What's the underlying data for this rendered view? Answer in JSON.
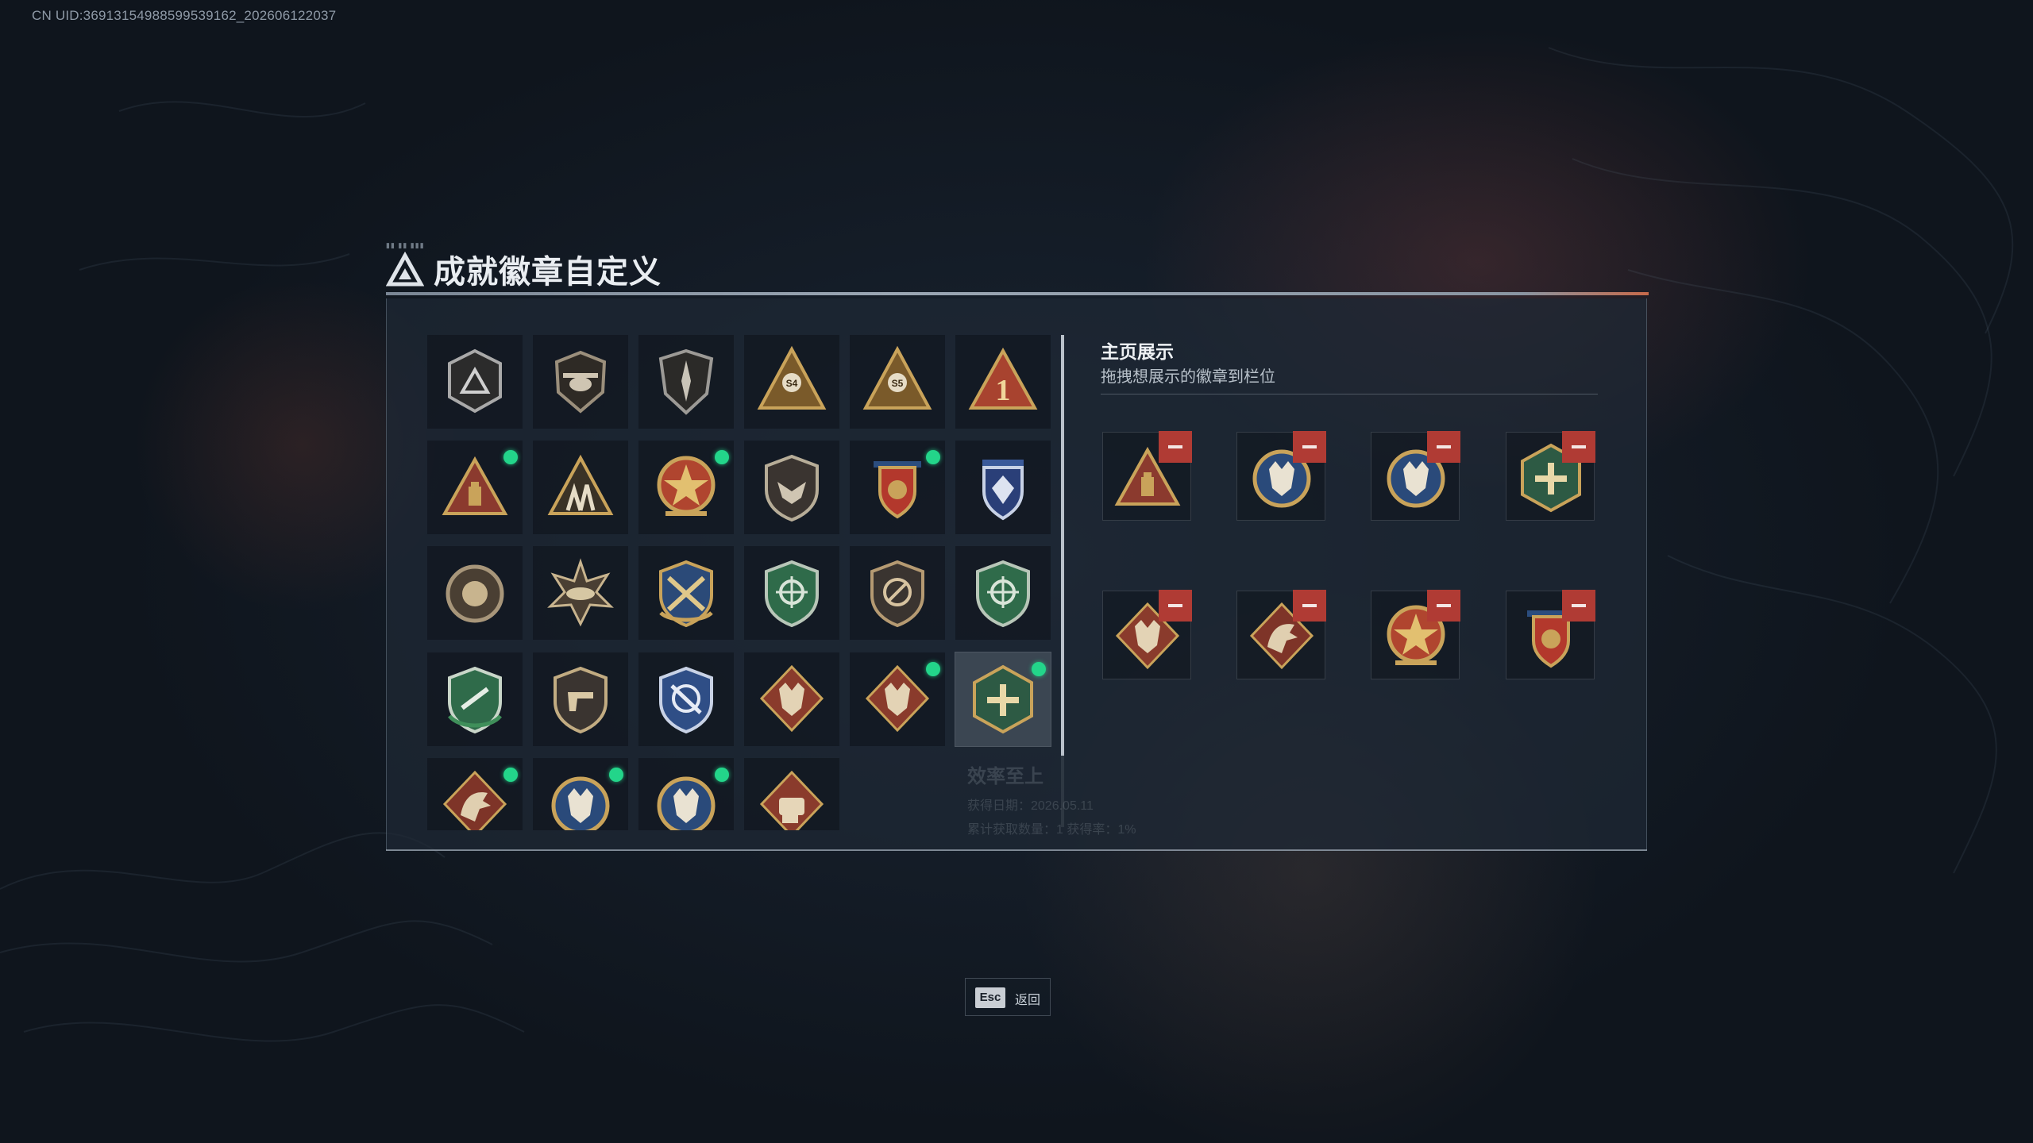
{
  "header": {
    "uid_text": "CN UID:369131549885995391​62_202606122037",
    "title": "成就徽章自定义"
  },
  "colors": {
    "accent_green": "#23d58a",
    "remove_red": "#b03b34",
    "gold": "#c9a35a"
  },
  "badges": [
    {
      "icon": "shield-triangle-badge-icon",
      "new": false
    },
    {
      "icon": "helicopter-shield-badge-icon",
      "new": false
    },
    {
      "icon": "winged-shield-badge-icon",
      "new": false
    },
    {
      "icon": "pyramid-s4-badge-icon",
      "new": false,
      "label": "S4"
    },
    {
      "icon": "pyramid-s5-badge-icon",
      "new": false,
      "label": "S5"
    },
    {
      "icon": "triangle-number-one-badge-icon",
      "new": false,
      "label": "1"
    },
    {
      "icon": "red-triangle-badge-icon",
      "new": true
    },
    {
      "icon": "gold-triangle-figures-badge-icon",
      "new": false
    },
    {
      "icon": "star-medal-badge-icon",
      "new": true
    },
    {
      "icon": "eagle-shield-badge-icon",
      "new": false
    },
    {
      "icon": "red-crest-badge-icon",
      "new": true
    },
    {
      "icon": "blue-crest-badge-icon",
      "new": false
    },
    {
      "icon": "round-emblem-badge-icon",
      "new": false
    },
    {
      "icon": "sunburst-badge-icon",
      "new": false
    },
    {
      "icon": "crossed-rifles-badge-icon",
      "new": false
    },
    {
      "icon": "green-crosshair-shield-badge-icon",
      "new": false
    },
    {
      "icon": "bronze-circle-shield-badge-icon",
      "new": false
    },
    {
      "icon": "green-crosshair-shield-badge-icon",
      "new": false
    },
    {
      "icon": "green-laurel-shield-badge-icon",
      "new": false
    },
    {
      "icon": "pistol-shield-badge-icon",
      "new": false
    },
    {
      "icon": "blue-crossed-rifles-badge-icon",
      "new": false
    },
    {
      "icon": "wolf-diamond-badge-icon",
      "new": false
    },
    {
      "icon": "wolf-diamond-badge-icon",
      "new": true
    },
    {
      "icon": "green-hexagon-badge-icon",
      "new": true
    },
    {
      "icon": "dragon-diamond-badge-icon",
      "new": true
    },
    {
      "icon": "blue-wolf-circle-badge-icon",
      "new": true
    },
    {
      "icon": "blue-wolf-circle-badge-icon",
      "new": true
    },
    {
      "icon": "fist-diamond-badge-icon",
      "new": false
    }
  ],
  "tooltip": {
    "name": "效率至上",
    "line1": "获得日期：2026.05.11",
    "line2": "累计获取数量：1  获得率：1%"
  },
  "showcase": {
    "title": "主页展示",
    "subtitle": "拖拽想展示的徽章到栏位",
    "slots": [
      {
        "icon": "red-triangle-badge-icon"
      },
      {
        "icon": "blue-wolf-circle-badge-icon"
      },
      {
        "icon": "blue-wolf-circle-badge-icon"
      },
      {
        "icon": "green-hexagon-badge-icon"
      },
      {
        "icon": "wolf-diamond-badge-icon"
      },
      {
        "icon": "dragon-diamond-badge-icon"
      },
      {
        "icon": "star-medal-badge-icon"
      },
      {
        "icon": "red-crest-badge-icon"
      }
    ]
  },
  "footer": {
    "esc_key": "Esc",
    "esc_label": "返回"
  }
}
